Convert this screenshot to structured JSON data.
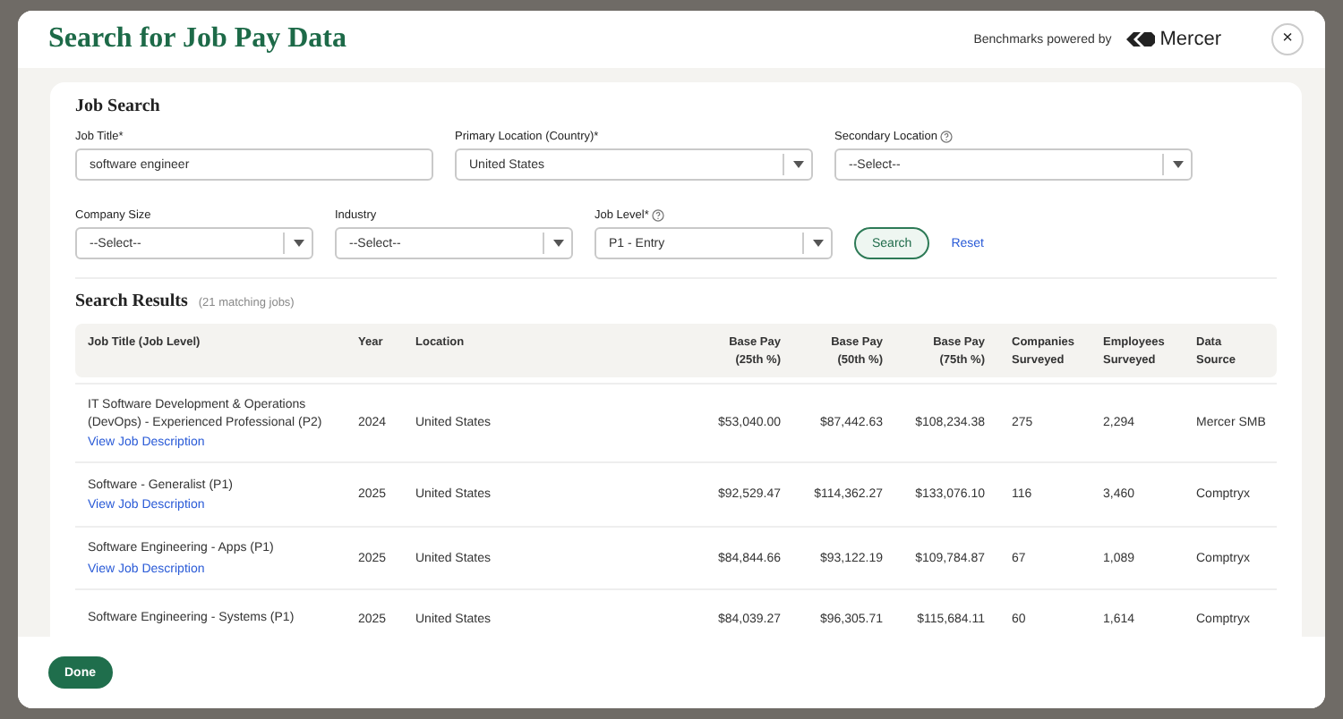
{
  "dialog": {
    "title": "Search for Job Pay Data",
    "powered_by": "Benchmarks powered by",
    "brand": "Mercer",
    "close": "×"
  },
  "job_search": {
    "title": "Job Search",
    "fields": [
      {
        "kind": "text",
        "label": "Job Title*",
        "value": "software engineer",
        "help": false
      },
      {
        "kind": "select",
        "label": "Primary Location (Country)*",
        "value": "United States",
        "help": false
      },
      {
        "kind": "select",
        "label": "Secondary Location",
        "value": "--Select--",
        "help": true
      },
      {
        "kind": "select",
        "label": "Company Size",
        "value": "--Select--",
        "help": false
      },
      {
        "kind": "select",
        "label": "Industry",
        "value": "--Select--",
        "help": false
      },
      {
        "kind": "select",
        "label": "Job Level*",
        "value": "P1 - Entry",
        "help": true
      }
    ],
    "search_button": "Search",
    "reset_link": "Reset"
  },
  "results": {
    "title": "Search Results",
    "count": "(21 matching jobs)",
    "columns": [
      "Job Title (Job Level)",
      "Year",
      "Location",
      "Base Pay\n(25th %)",
      "Base Pay\n(50th %)",
      "Base Pay\n(75th %)",
      "Companies\nSurveyed",
      "Employees\nSurveyed",
      "Data\nSource"
    ],
    "rows": [
      {
        "title": "IT Software Development & Operations (DevOps) - Experienced Professional (P2)",
        "link": "View Job Description",
        "year": "2024",
        "location": "United States",
        "p25": "$53,040.00",
        "p50": "$87,442.63",
        "p75": "$108,234.38",
        "companies": "275",
        "employees": "2,294",
        "source": "Mercer SMB"
      },
      {
        "title": "Software - Generalist (P1)",
        "link": "View Job Description",
        "year": "2025",
        "location": "United States",
        "p25": "$92,529.47",
        "p50": "$114,362.27",
        "p75": "$133,076.10",
        "companies": "116",
        "employees": "3,460",
        "source": "Comptryx"
      },
      {
        "title": "Software Engineering - Apps (P1)",
        "link": "View Job Description",
        "year": "2025",
        "location": "United States",
        "p25": "$84,844.66",
        "p50": "$93,122.19",
        "p75": "$109,784.87",
        "companies": "67",
        "employees": "1,089",
        "source": "Comptryx"
      },
      {
        "title": "Software Engineering - Systems (P1)",
        "year": "2025",
        "location": "United States",
        "p25": "$84,039.27",
        "p50": "$96,305.71",
        "p75": "$115,684.11",
        "companies": "60",
        "employees": "1,614",
        "source": "Comptryx"
      }
    ]
  },
  "footer": {
    "done_button": "Done"
  }
}
